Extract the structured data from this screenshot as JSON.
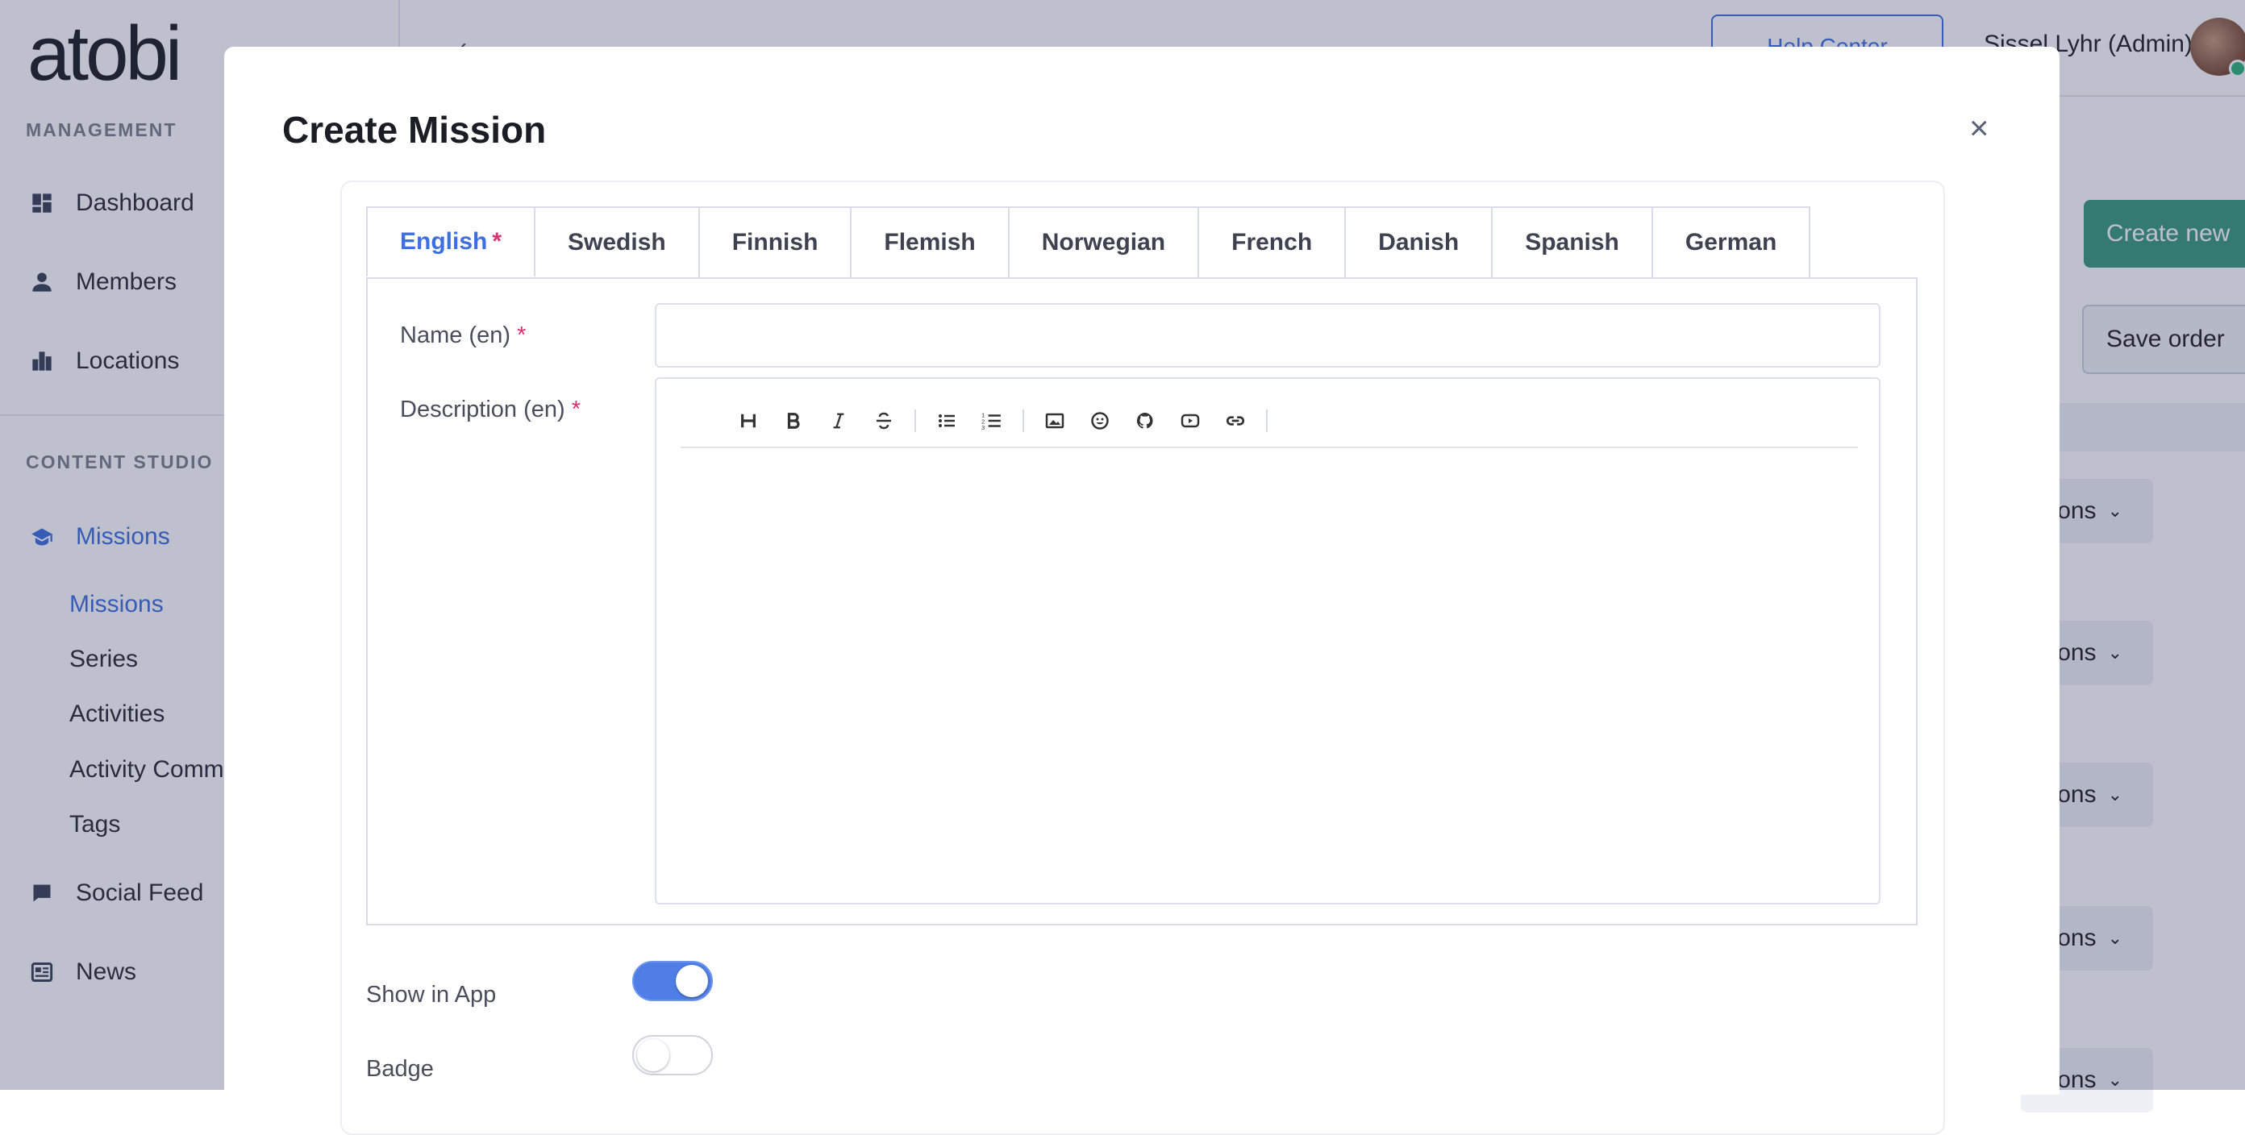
{
  "app": {
    "logo_text": "atobi"
  },
  "sidebar": {
    "management_title": "MANAGEMENT",
    "management_items": [
      {
        "label": "Dashboard",
        "icon": "dashboard-icon"
      },
      {
        "label": "Members",
        "icon": "person-icon"
      },
      {
        "label": "Locations",
        "icon": "building-icon"
      }
    ],
    "content_title": "CONTENT STUDIO",
    "missions_label": "Missions",
    "missions_icon": "graduation-cap-icon",
    "sub_items": [
      "Missions",
      "Series",
      "Activities",
      "Activity Comme",
      "Tags"
    ],
    "bottom_items": [
      {
        "label": "Social Feed",
        "icon": "chat-bubble-icon"
      },
      {
        "label": "News",
        "icon": "newspaper-icon"
      }
    ]
  },
  "topbar": {
    "help_center": "Help Center",
    "user_name": "Sissel Lyhr (Admin)"
  },
  "page": {
    "create_new": "Create new",
    "save_order": "Save order",
    "actions_label": "ons",
    "accent_color": "#3d6fe0",
    "create_color": "#3a9a7a"
  },
  "modal": {
    "title": "Create Mission",
    "close_symbol": "×",
    "tabs": [
      {
        "label": "English",
        "required": "*"
      },
      {
        "label": "Swedish"
      },
      {
        "label": "Finnish"
      },
      {
        "label": "Flemish"
      },
      {
        "label": "Norwegian"
      },
      {
        "label": "French"
      },
      {
        "label": "Danish"
      },
      {
        "label": "Spanish"
      },
      {
        "label": "German"
      }
    ],
    "name_label": "Name (en)",
    "description_label": "Description (en)",
    "required_mark": "*",
    "name_value": "",
    "description_value": "",
    "toolbar": [
      "heading-icon",
      "bold-icon",
      "italic-icon",
      "strikethrough-icon",
      "bullet-list-icon",
      "numbered-list-icon",
      "image-icon",
      "emoji-icon",
      "github-icon",
      "youtube-icon",
      "link-icon"
    ],
    "show_in_app_label": "Show in App",
    "show_in_app_on": true,
    "badge_label": "Badge",
    "badge_on": false
  }
}
